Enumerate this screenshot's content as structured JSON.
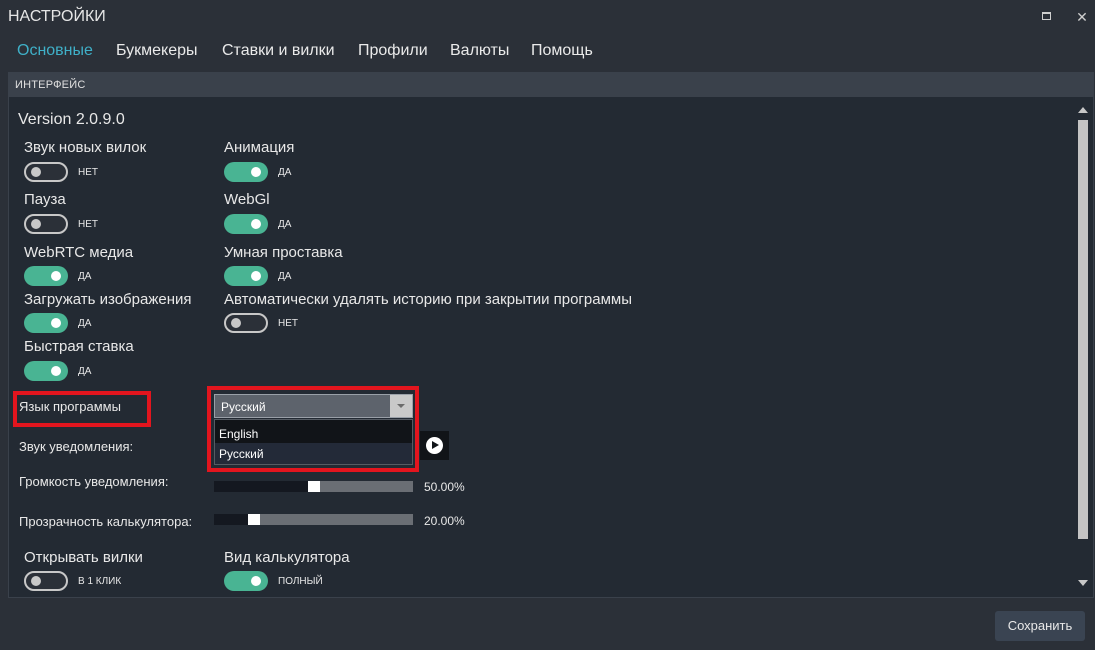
{
  "window": {
    "title": "НАСТРОЙКИ",
    "close_glyph": "✕"
  },
  "menu": {
    "items": [
      "Основные",
      "Букмекеры",
      "Ставки и вилки",
      "Профили",
      "Валюты",
      "Помощь"
    ],
    "active": "Основные"
  },
  "section": {
    "title": "ИНТЕРФЕЙС"
  },
  "version": "Version 2.0.9.0",
  "toggles": [
    {
      "label": "Звук новых вилок",
      "state": "НЕТ",
      "on": false
    },
    {
      "label": "Анимация",
      "state": "ДА",
      "on": true
    },
    {
      "label": "Пауза",
      "state": "НЕТ",
      "on": false
    },
    {
      "label": "WebGl",
      "state": "ДА",
      "on": true
    },
    {
      "label": "WebRTC медиа",
      "state": "ДА",
      "on": true
    },
    {
      "label": "Умная проставка",
      "state": "ДА",
      "on": true
    },
    {
      "label": "Загружать изображения",
      "state": "ДА",
      "on": true
    },
    {
      "label": "Автоматически удалять историю при закрытии программы",
      "state": "НЕТ",
      "on": false
    },
    {
      "label": "Быстрая ставка",
      "state": "ДА",
      "on": true
    },
    {
      "label": "Открывать вилки",
      "state": "В 1 КЛИК",
      "on": false
    },
    {
      "label": "Вид калькулятора",
      "state": "ПОЛНЫЙ",
      "on": true
    }
  ],
  "language": {
    "label": "Язык программы",
    "selected": "Русский",
    "options": [
      "English",
      "Русский"
    ]
  },
  "sound": {
    "label": "Звук уведомления:"
  },
  "volume": {
    "label": "Громкость уведомления:",
    "value": "50.00%",
    "fraction": 0.5
  },
  "opacity": {
    "label": "Прозрачность калькулятора:",
    "value": "20.00%",
    "fraction": 0.2
  },
  "save_label": "Сохранить",
  "colors": {
    "accent": "#3fb0c8",
    "toggle_on": "#49b493",
    "highlight": "#e3151e",
    "background": "#2b3038"
  }
}
